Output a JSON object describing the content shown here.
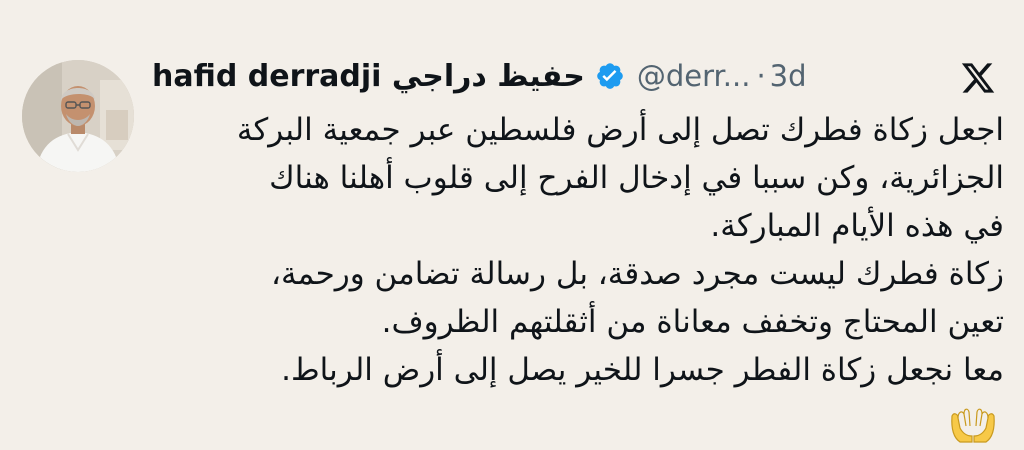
{
  "tweet": {
    "author": {
      "display_name": "hafid derradji حفيظ دراجي",
      "handle": "@derr...",
      "verified": true,
      "avatar_icon": "profile-photo"
    },
    "separator": "·",
    "timestamp": "3d",
    "platform_icon": "x-logo-icon",
    "lines": [
      "اجعل زكاة فطرك تصل إلى أرض فلسطين عبر جمعية البركة",
      "الجزائرية، وكن سببا في إدخال الفرح إلى قلوب أهلنا هناك",
      "في هذه الأيام المباركة.",
      "زكاة فطرك ليست مجرد صدقة، بل رسالة تضامن ورحمة،",
      "تعين المحتاج وتخفف معاناة من أثقلتهم الظروف.",
      "معا نجعل زكاة الفطر جسرا للخير يصل إلى أرض الرباط."
    ],
    "emoji": "🤲",
    "colors": {
      "background": "#f3efe9",
      "text": "#0f1419",
      "secondary": "#536471",
      "verified": "#1d9bf0"
    }
  }
}
